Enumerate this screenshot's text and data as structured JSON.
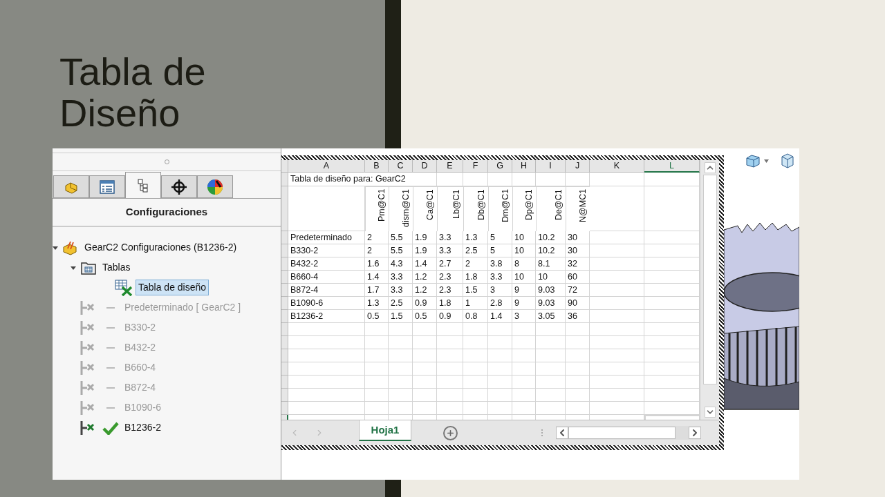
{
  "slide": {
    "title": "Tabla de Diseño"
  },
  "panel": {
    "tabs": [
      {
        "kind": "part",
        "selected": false
      },
      {
        "kind": "properties",
        "selected": false
      },
      {
        "kind": "configurations",
        "selected": true
      },
      {
        "kind": "target",
        "selected": false
      },
      {
        "kind": "appearance",
        "selected": false
      }
    ],
    "heading": "Configuraciones",
    "tree": [
      {
        "label": "GearC2 Configuraciones  (B1236-2)",
        "kind": "part",
        "expanded": true,
        "selected": false,
        "children": [
          {
            "label": "Tablas",
            "kind": "folder",
            "expanded": true,
            "selected": false,
            "children": [
              {
                "label": "Tabla de diseño",
                "kind": "design-table",
                "selected": true
              }
            ]
          },
          {
            "label": "Predeterminado [ GearC2 ]",
            "kind": "config",
            "active": false,
            "selected": false
          },
          {
            "label": "B330-2",
            "kind": "config",
            "active": false,
            "selected": false
          },
          {
            "label": "B432-2",
            "kind": "config",
            "active": false,
            "selected": false
          },
          {
            "label": "B660-4",
            "kind": "config",
            "active": false,
            "selected": false
          },
          {
            "label": "B872-4",
            "kind": "config",
            "active": false,
            "selected": false
          },
          {
            "label": "B1090-6",
            "kind": "config",
            "active": false,
            "selected": false
          },
          {
            "label": "B1236-2",
            "kind": "config",
            "active": true,
            "selected": false
          }
        ]
      }
    ]
  },
  "sheet": {
    "columns": [
      {
        "label": "A",
        "selected": false
      },
      {
        "label": "B",
        "selected": false
      },
      {
        "label": "C",
        "selected": false
      },
      {
        "label": "D",
        "selected": false
      },
      {
        "label": "E",
        "selected": false
      },
      {
        "label": "F",
        "selected": false
      },
      {
        "label": "G",
        "selected": false
      },
      {
        "label": "H",
        "selected": false
      },
      {
        "label": "I",
        "selected": false
      },
      {
        "label": "J",
        "selected": false
      },
      {
        "label": "K",
        "selected": false
      },
      {
        "label": "L",
        "selected": true
      }
    ],
    "title_cell": "Tabla de diseño para: GearC2",
    "params": [
      "Pm@C1",
      "dism@C1",
      "Ca@C1",
      "Lb@C1",
      "Db@C1",
      "Dm@C1",
      "Dp@C1",
      "De@C1",
      "N@MC1"
    ],
    "rows": [
      {
        "name": "Predeterminado",
        "values": [
          "2",
          "5.5",
          "1.9",
          "3.3",
          "1.3",
          "5",
          "10",
          "10.2",
          "30"
        ]
      },
      {
        "name": "B330-2",
        "values": [
          "2",
          "5.5",
          "1.9",
          "3.3",
          "2.5",
          "5",
          "10",
          "10.2",
          "30"
        ]
      },
      {
        "name": "B432-2",
        "values": [
          "1.6",
          "4.3",
          "1.4",
          "2.7",
          "2",
          "3.8",
          "8",
          "8.1",
          "32"
        ]
      },
      {
        "name": "B660-4",
        "values": [
          "1.4",
          "3.3",
          "1.2",
          "2.3",
          "1.8",
          "3.3",
          "10",
          "10",
          "60"
        ]
      },
      {
        "name": "B872-4",
        "values": [
          "1.7",
          "3.3",
          "1.2",
          "2.3",
          "1.5",
          "3",
          "9",
          "9.03",
          "72"
        ]
      },
      {
        "name": "B1090-6",
        "values": [
          "1.3",
          "2.5",
          "0.9",
          "1.8",
          "1",
          "2.8",
          "9",
          "9.03",
          "90"
        ]
      },
      {
        "name": "B1236-2",
        "values": [
          "0.5",
          "1.5",
          "0.5",
          "0.9",
          "0.8",
          "1.4",
          "3",
          "3.05",
          "36"
        ]
      }
    ],
    "sheet_tabs": [
      {
        "label": "Hoja1",
        "selected": true
      }
    ]
  }
}
